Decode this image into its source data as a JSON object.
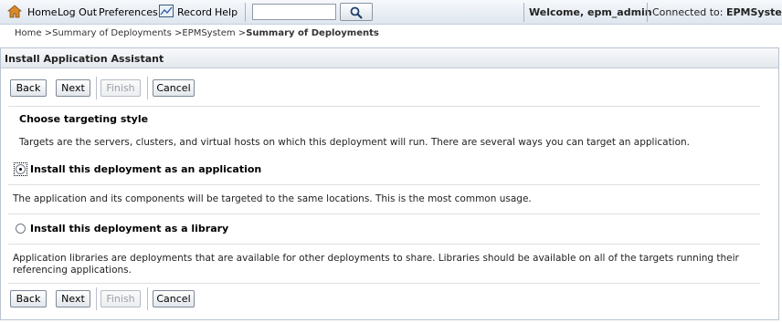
{
  "toolbar": {
    "home": "Home",
    "logout": "Log Out",
    "preferences": "Preferences",
    "record": "Record",
    "help": "Help",
    "search_value": "",
    "welcome": "Welcome, epm_admin",
    "connected_prefix": "Connected to:",
    "connected_domain": "EPMSystem"
  },
  "breadcrumb": {
    "items": [
      "Home >",
      "Summary of Deployments >",
      "EPMSystem >"
    ],
    "current": "Summary of Deployments"
  },
  "panel": {
    "title": "Install Application Assistant"
  },
  "buttons": {
    "back": "Back",
    "next": "Next",
    "finish": "Finish",
    "cancel": "Cancel"
  },
  "content": {
    "section_title": "Choose targeting style",
    "intro": "Targets are the servers, clusters, and virtual hosts on which this deployment will run. There are several ways you can target an application.",
    "options": [
      {
        "label": "Install this deployment as an application",
        "description": "The application and its components will be targeted to the same locations. This is the most common usage.",
        "selected": true
      },
      {
        "label": "Install this deployment as a library",
        "description": "Application libraries are deployments that are available for other deployments to share. Libraries should be available on all of the targets running their referencing applications.",
        "selected": false
      }
    ]
  },
  "icons": {
    "home": "home-icon",
    "record": "record-icon",
    "search": "search-icon"
  },
  "colors": {
    "toolbar_bg": "#dfe6ef",
    "panel_border": "#b9c3cf",
    "disabled_text": "#9aa0a8"
  }
}
